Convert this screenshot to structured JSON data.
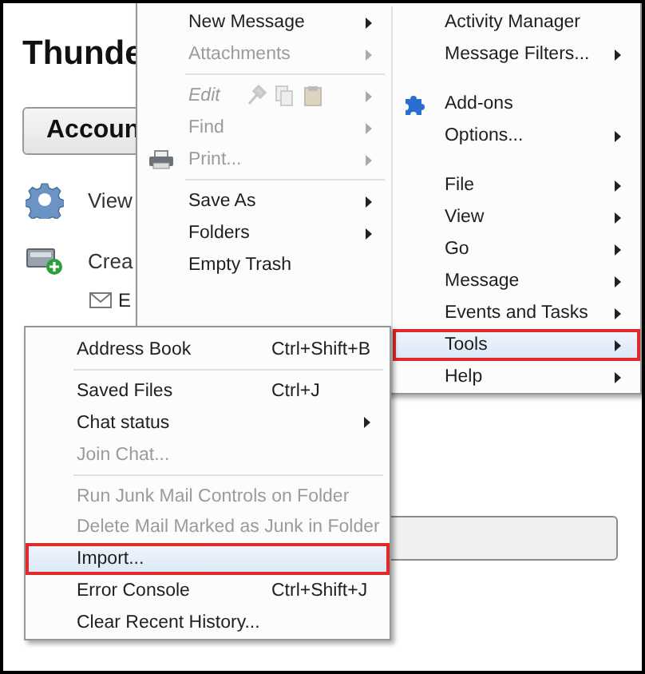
{
  "background": {
    "title": "Thunde",
    "account_button": "Accoun",
    "actions": [
      {
        "kind": "settings",
        "label": "View"
      },
      {
        "kind": "compose",
        "label": "Crea"
      }
    ],
    "mail_link": "E"
  },
  "app_menu": {
    "columns": [
      [
        {
          "kind": "item",
          "label": "New Message",
          "disabled": false,
          "submenu": true,
          "selected": false
        },
        {
          "kind": "item",
          "label": "Attachments",
          "disabled": true,
          "submenu": true,
          "selected": false
        },
        {
          "kind": "separator"
        },
        {
          "kind": "clipboard",
          "label": "Edit",
          "disabled": true,
          "submenu": true,
          "selected": false
        },
        {
          "kind": "item",
          "label": "Find",
          "disabled": true,
          "submenu": true,
          "selected": false
        },
        {
          "kind": "print",
          "label": "Print...",
          "disabled": true,
          "submenu": true,
          "selected": false
        },
        {
          "kind": "separator"
        },
        {
          "kind": "item",
          "label": "Save As",
          "disabled": false,
          "submenu": true,
          "selected": false
        },
        {
          "kind": "item",
          "label": "Folders",
          "disabled": false,
          "submenu": true,
          "selected": false
        },
        {
          "kind": "item",
          "label": "Empty Trash",
          "disabled": false,
          "submenu": false,
          "selected": false
        }
      ],
      [
        {
          "kind": "item",
          "label": "Activity Manager",
          "disabled": false,
          "submenu": false,
          "selected": false
        },
        {
          "kind": "item",
          "label": "Message Filters...",
          "disabled": false,
          "submenu": true,
          "selected": false
        },
        {
          "kind": "spacer"
        },
        {
          "kind": "addon",
          "label": "Add-ons",
          "disabled": false,
          "submenu": false,
          "selected": false
        },
        {
          "kind": "item",
          "label": "Options...",
          "disabled": false,
          "submenu": true,
          "selected": false
        },
        {
          "kind": "spacer"
        },
        {
          "kind": "item",
          "label": "File",
          "disabled": false,
          "submenu": true,
          "selected": false
        },
        {
          "kind": "item",
          "label": "View",
          "disabled": false,
          "submenu": true,
          "selected": false
        },
        {
          "kind": "item",
          "label": "Go",
          "disabled": false,
          "submenu": true,
          "selected": false
        },
        {
          "kind": "item",
          "label": "Message",
          "disabled": false,
          "submenu": true,
          "selected": false
        },
        {
          "kind": "item",
          "label": "Events and Tasks",
          "disabled": false,
          "submenu": true,
          "selected": false
        },
        {
          "kind": "item",
          "label": "Tools",
          "disabled": false,
          "submenu": true,
          "selected": true
        },
        {
          "kind": "item",
          "label": "Help",
          "disabled": false,
          "submenu": true,
          "selected": false
        }
      ]
    ]
  },
  "tools_menu": {
    "items": [
      {
        "kind": "item",
        "label": "Address Book",
        "shortcut": "Ctrl+Shift+B",
        "disabled": false,
        "submenu": false,
        "selected": false
      },
      {
        "kind": "separator"
      },
      {
        "kind": "item",
        "label": "Saved Files",
        "shortcut": "Ctrl+J",
        "disabled": false,
        "submenu": false,
        "selected": false
      },
      {
        "kind": "item",
        "label": "Chat status",
        "disabled": false,
        "submenu": true,
        "selected": false
      },
      {
        "kind": "item",
        "label": "Join Chat...",
        "disabled": true,
        "submenu": false,
        "selected": false
      },
      {
        "kind": "separator"
      },
      {
        "kind": "item",
        "label": "Run Junk Mail Controls on Folder",
        "disabled": true,
        "submenu": false,
        "selected": false
      },
      {
        "kind": "item",
        "label": "Delete Mail Marked as Junk in Folder",
        "disabled": true,
        "submenu": false,
        "selected": false
      },
      {
        "kind": "item",
        "label": "Import...",
        "disabled": false,
        "submenu": false,
        "selected": true
      },
      {
        "kind": "item",
        "label": "Error Console",
        "shortcut": "Ctrl+Shift+J",
        "disabled": false,
        "submenu": false,
        "selected": false
      },
      {
        "kind": "item",
        "label": "Clear Recent History...",
        "disabled": false,
        "submenu": false,
        "selected": false
      }
    ]
  }
}
